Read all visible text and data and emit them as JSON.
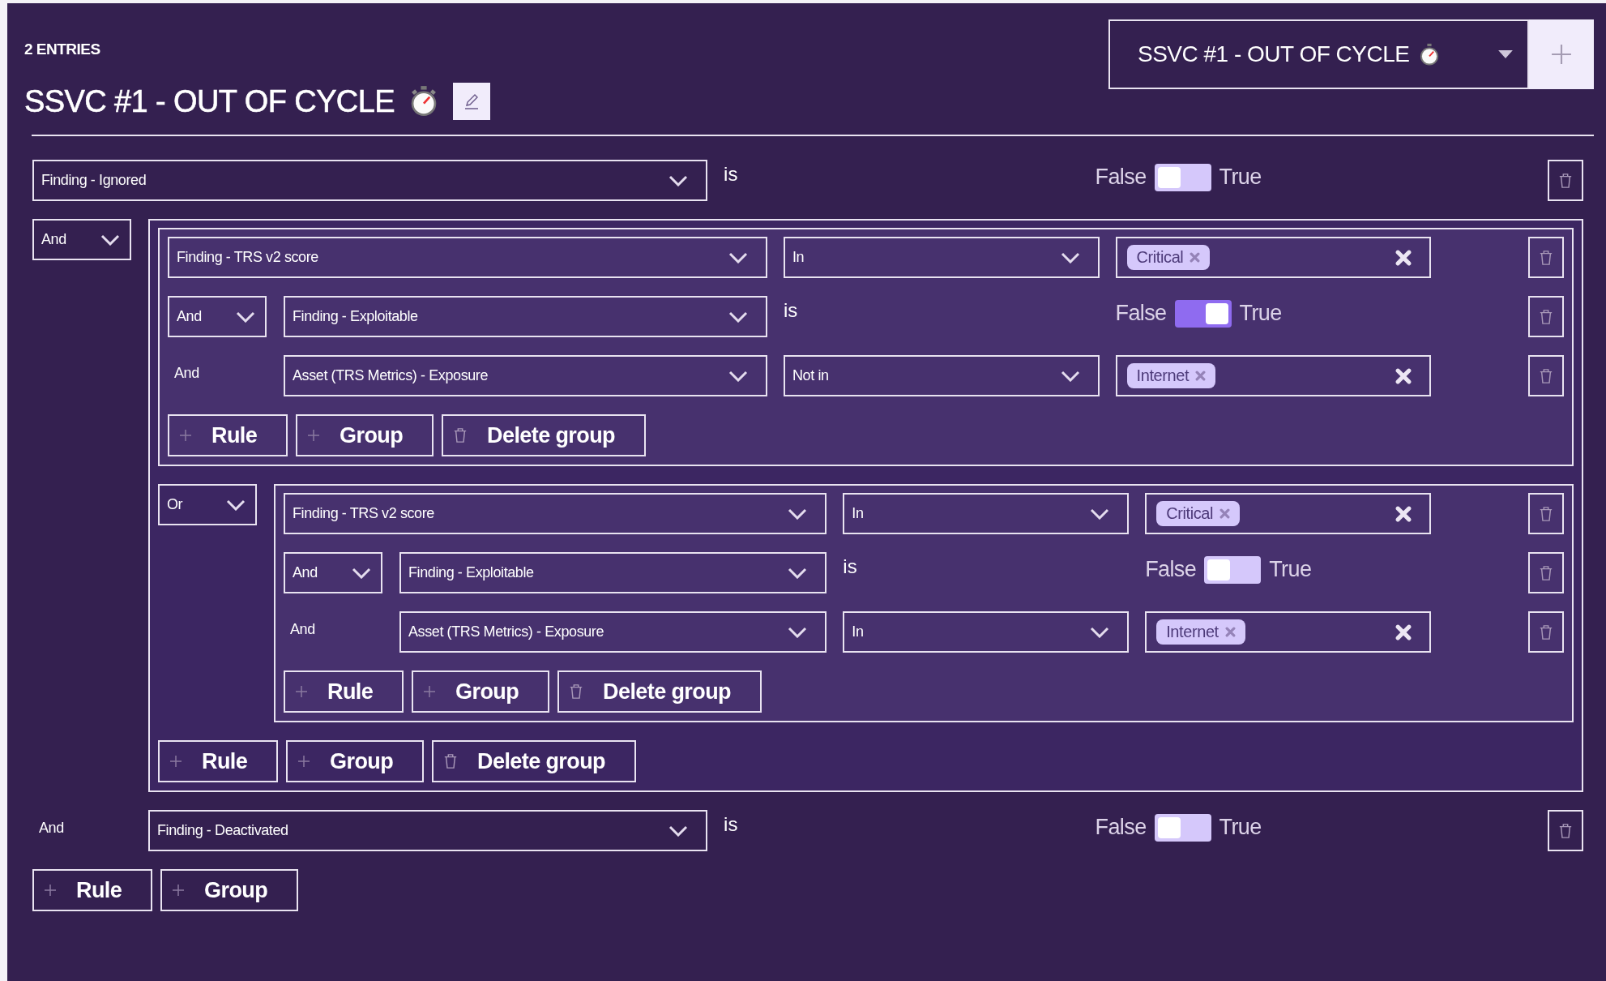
{
  "entries_count": "2 ENTRIES",
  "title": "SSVC #1 - OUT OF CYCLE",
  "entry_select": {
    "value": "SSVC #1 - OUT OF CYCLE"
  },
  "query": {
    "children": [
      {
        "kind": "rule",
        "field": "Finding - Ignored",
        "operator": {
          "kind": "text",
          "text": "is"
        },
        "value": {
          "kind": "toggle",
          "false_label": "False",
          "true_label": "True",
          "on": false
        }
      },
      {
        "kind": "group",
        "combinator": {
          "kind": "select",
          "text": "And"
        },
        "children": [
          {
            "kind": "group",
            "children": [
              {
                "kind": "rule",
                "field": "Finding - TRS v2 score",
                "operator": {
                  "kind": "select",
                  "text": "In"
                },
                "value": {
                  "kind": "tags",
                  "tags": [
                    "Critical"
                  ]
                }
              },
              {
                "kind": "rule",
                "combinator": {
                  "kind": "select",
                  "text": "And"
                },
                "field": "Finding - Exploitable",
                "operator": {
                  "kind": "text",
                  "text": "is"
                },
                "value": {
                  "kind": "toggle",
                  "false_label": "False",
                  "true_label": "True",
                  "on": true
                }
              },
              {
                "kind": "rule",
                "combinator": {
                  "kind": "label",
                  "text": "And"
                },
                "field": "Asset (TRS Metrics) - Exposure",
                "operator": {
                  "kind": "select",
                  "text": "Not in"
                },
                "value": {
                  "kind": "tags",
                  "tags": [
                    "Internet"
                  ]
                }
              }
            ],
            "buttons": [
              {
                "kind": "add",
                "label": "Rule"
              },
              {
                "kind": "add",
                "label": "Group"
              },
              {
                "kind": "delete",
                "label": "Delete group"
              }
            ]
          },
          {
            "kind": "group",
            "combinator": {
              "kind": "select",
              "text": "Or"
            },
            "children": [
              {
                "kind": "rule",
                "field": "Finding - TRS v2 score",
                "operator": {
                  "kind": "select",
                  "text": "In"
                },
                "value": {
                  "kind": "tags",
                  "tags": [
                    "Critical"
                  ]
                }
              },
              {
                "kind": "rule",
                "combinator": {
                  "kind": "select",
                  "text": "And"
                },
                "field": "Finding - Exploitable",
                "operator": {
                  "kind": "text",
                  "text": "is"
                },
                "value": {
                  "kind": "toggle",
                  "false_label": "False",
                  "true_label": "True",
                  "on": false
                }
              },
              {
                "kind": "rule",
                "combinator": {
                  "kind": "label",
                  "text": "And"
                },
                "field": "Asset (TRS Metrics) - Exposure",
                "operator": {
                  "kind": "select",
                  "text": "In"
                },
                "value": {
                  "kind": "tags",
                  "tags": [
                    "Internet"
                  ]
                }
              }
            ],
            "buttons": [
              {
                "kind": "add",
                "label": "Rule"
              },
              {
                "kind": "add",
                "label": "Group"
              },
              {
                "kind": "delete",
                "label": "Delete group"
              }
            ]
          }
        ],
        "buttons": [
          {
            "kind": "add",
            "label": "Rule"
          },
          {
            "kind": "add",
            "label": "Group"
          },
          {
            "kind": "delete",
            "label": "Delete group"
          }
        ]
      },
      {
        "kind": "rule",
        "combinator": {
          "kind": "label",
          "text": "And"
        },
        "field": "Finding - Deactivated",
        "operator": {
          "kind": "text",
          "text": "is"
        },
        "value": {
          "kind": "toggle",
          "false_label": "False",
          "true_label": "True",
          "on": false
        }
      }
    ],
    "buttons": [
      {
        "kind": "add",
        "label": "Rule"
      },
      {
        "kind": "add",
        "label": "Group"
      }
    ]
  }
}
